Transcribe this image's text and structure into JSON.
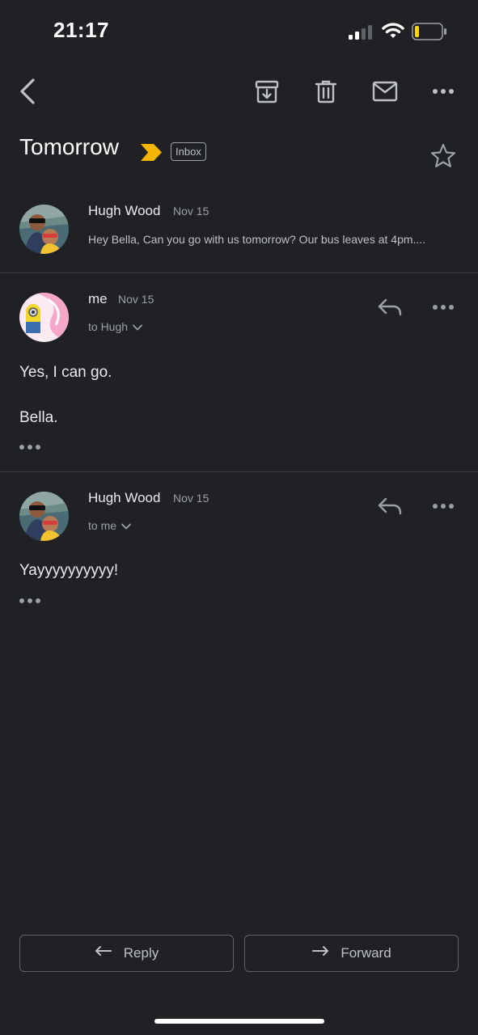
{
  "status_bar": {
    "time": "21:17"
  },
  "thread": {
    "subject": "Tomorrow",
    "label": "Inbox"
  },
  "messages": [
    {
      "sender": "Hugh Wood",
      "date": "Nov 15",
      "snippet": "Hey Bella, Can you go with us tomorrow? Our bus leaves at 4pm...."
    },
    {
      "sender": "me",
      "date": "Nov 15",
      "to": "to Hugh",
      "body": [
        "Yes, I can go.",
        "Bella."
      ]
    },
    {
      "sender": "Hugh Wood",
      "date": "Nov 15",
      "to": "to me",
      "body": [
        "Yayyyyyyyyyy!"
      ]
    }
  ],
  "actions": {
    "reply_label": "Reply",
    "forward_label": "Forward"
  },
  "colors": {
    "background": "#202124",
    "important_marker": "#f5b400",
    "battery_level": "#ffd60a"
  },
  "status": {
    "battery_fraction": 0.15
  }
}
